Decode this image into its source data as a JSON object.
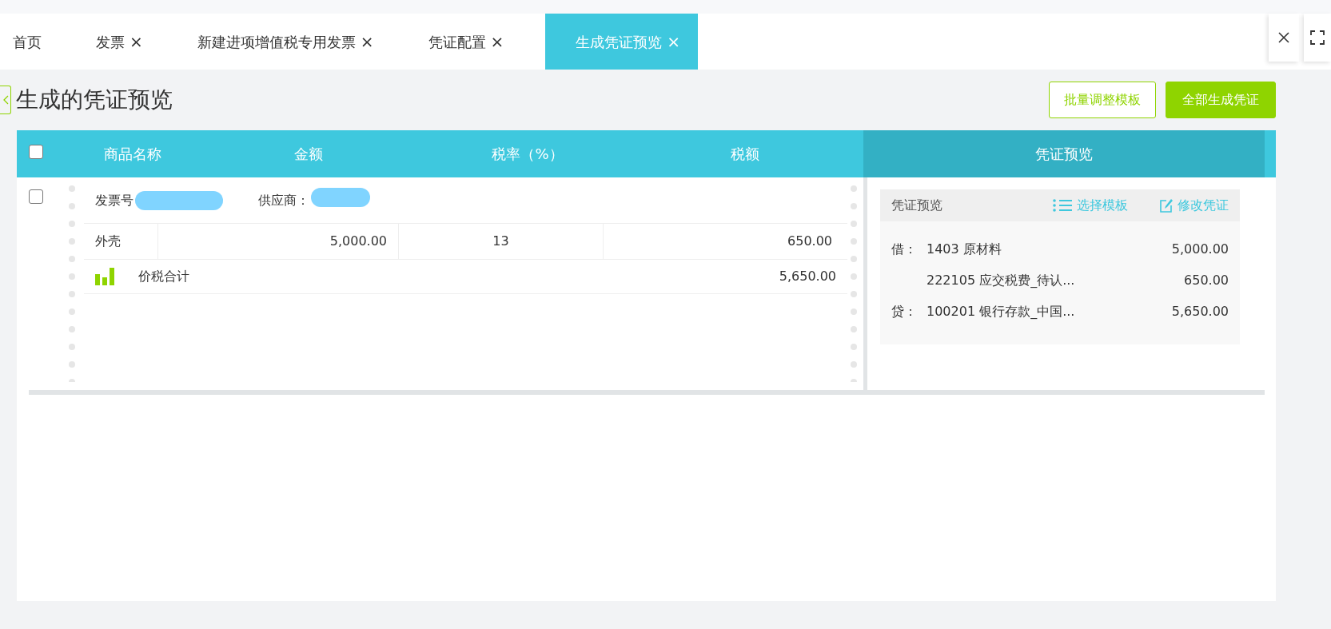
{
  "tabs": [
    {
      "label": "首页",
      "closable": false,
      "selected": false
    },
    {
      "label": "发票",
      "closable": true,
      "selected": false
    },
    {
      "label": "新建进项增值税专用发票",
      "closable": true,
      "selected": false
    },
    {
      "label": "凭证配置",
      "closable": true,
      "selected": false
    },
    {
      "label": "生成凭证预览",
      "closable": true,
      "selected": true
    }
  ],
  "tab_close_glyph": "×",
  "page_title": "生成的凭证预览",
  "buttons": [
    {
      "label": "批量调整模板",
      "kind": "outline"
    },
    {
      "label": "全部生成凭证",
      "kind": "solid"
    }
  ],
  "table": {
    "select_all_checked": false,
    "columns": [
      "商品名称",
      "金额",
      "税率（%）",
      "税额"
    ],
    "voucher_column": "凭证预览"
  },
  "invoices": [
    {
      "checked": false,
      "invoice_no_label": "发票号",
      "supplier_label": "供应商：",
      "items": [
        {
          "name": "外壳",
          "amount": "5,000.00",
          "rate": "13",
          "tax": "650.00"
        }
      ],
      "total_label": "价税合计",
      "total": "5,650.00",
      "voucher": {
        "title": "凭证预览",
        "actions": [
          {
            "label": "选择模板"
          },
          {
            "label": "修改凭证"
          }
        ],
        "entries": [
          {
            "side": "借：",
            "account": "1403 原材料",
            "amount": "5,000.00"
          },
          {
            "account": "222105 应交税费_待认...",
            "amount": "650.00"
          },
          {
            "side": "贷：",
            "account": "100201 银行存款_中国...",
            "amount": "5,650.00"
          }
        ]
      }
    }
  ]
}
